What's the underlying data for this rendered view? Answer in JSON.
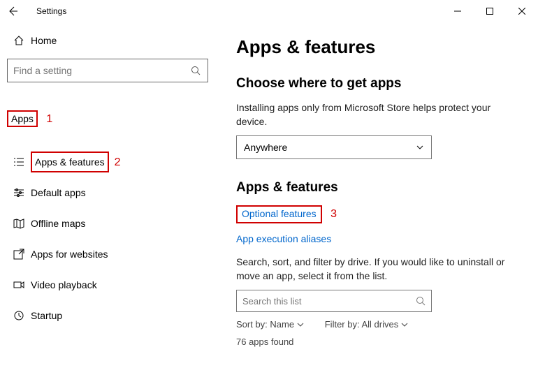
{
  "title": "Settings",
  "sidebar": {
    "home": "Home",
    "search_placeholder": "Find a setting",
    "section": "Apps",
    "annot1": "1",
    "items": [
      {
        "label": "Apps & features"
      },
      {
        "label": "Default apps"
      },
      {
        "label": "Offline maps"
      },
      {
        "label": "Apps for websites"
      },
      {
        "label": "Video playback"
      },
      {
        "label": "Startup"
      }
    ],
    "annot2": "2"
  },
  "content": {
    "h1": "Apps & features",
    "where_h2": "Choose where to get apps",
    "where_p": "Installing apps only from Microsoft Store helps protect your device.",
    "where_dropdown": "Anywhere",
    "af_h2": "Apps & features",
    "link_optional": "Optional features",
    "annot3": "3",
    "link_aliases": "App execution aliases",
    "filter_p": "Search, sort, and filter by drive. If you would like to uninstall or move an app, select it from the list.",
    "search_placeholder": "Search this list",
    "sort_label": "Sort by:",
    "sort_value": "Name",
    "filter_label": "Filter by:",
    "filter_value": "All drives",
    "count": "76 apps found"
  }
}
